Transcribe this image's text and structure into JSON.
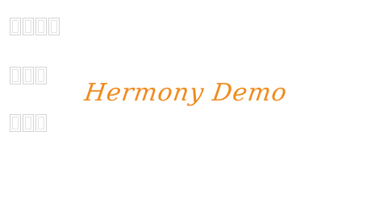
{
  "preview": {
    "text": "Hermony Demo",
    "color": "#f08a1c"
  },
  "missing_glyph_rows": [
    {
      "count": 4
    },
    {
      "count": 3
    },
    {
      "count": 3
    }
  ],
  "colors": {
    "background": "#ffffff",
    "missing_glyph_border": "#d4d4d4"
  }
}
